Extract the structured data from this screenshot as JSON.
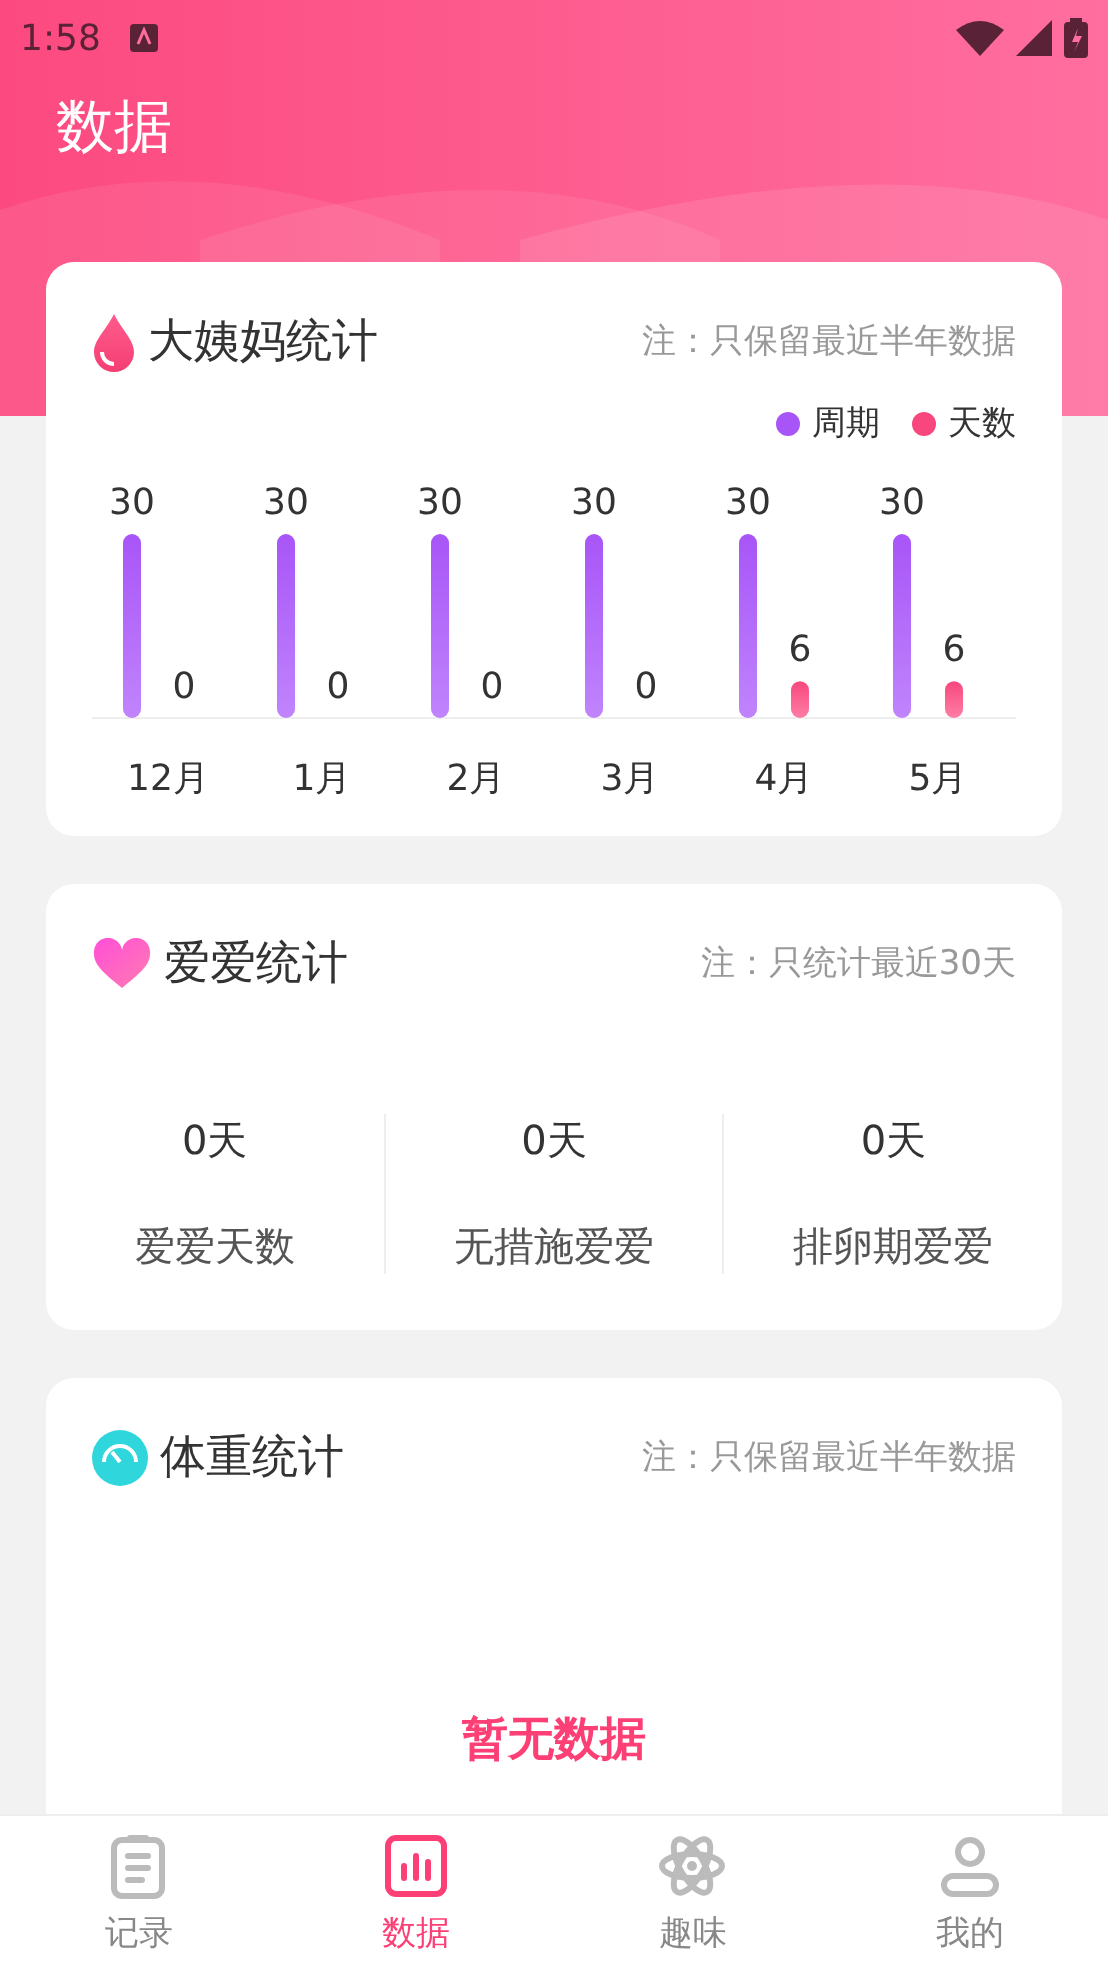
{
  "status_bar": {
    "time": "1:58"
  },
  "header": {
    "title": "数据"
  },
  "period_card": {
    "title": "大姨妈统计",
    "note": "注：只保留最近半年数据",
    "chart_data": {
      "type": "bar",
      "categories": [
        "12月",
        "1月",
        "2月",
        "3月",
        "4月",
        "5月"
      ],
      "data_labels": true,
      "series": [
        {
          "name": "周期",
          "color": "#a855f7",
          "values": [
            30,
            30,
            30,
            30,
            30,
            30
          ]
        },
        {
          "name": "天数",
          "color": "#f7477e",
          "values": [
            0,
            0,
            0,
            0,
            6,
            6
          ]
        }
      ]
    }
  },
  "love_card": {
    "title": "爱爱统计",
    "note": "注：只统计最近30天",
    "stats": [
      {
        "value": "0天",
        "label": "爱爱天数"
      },
      {
        "value": "0天",
        "label": "无措施爱爱"
      },
      {
        "value": "0天",
        "label": "排卵期爱爱"
      }
    ]
  },
  "weight_card": {
    "title": "体重统计",
    "note": "注：只保留最近半年数据",
    "empty_text": "暂无数据"
  },
  "tabs": [
    {
      "label": "记录",
      "selected": false
    },
    {
      "label": "数据",
      "selected": true
    },
    {
      "label": "趣味",
      "selected": false
    },
    {
      "label": "我的",
      "selected": false
    }
  ]
}
